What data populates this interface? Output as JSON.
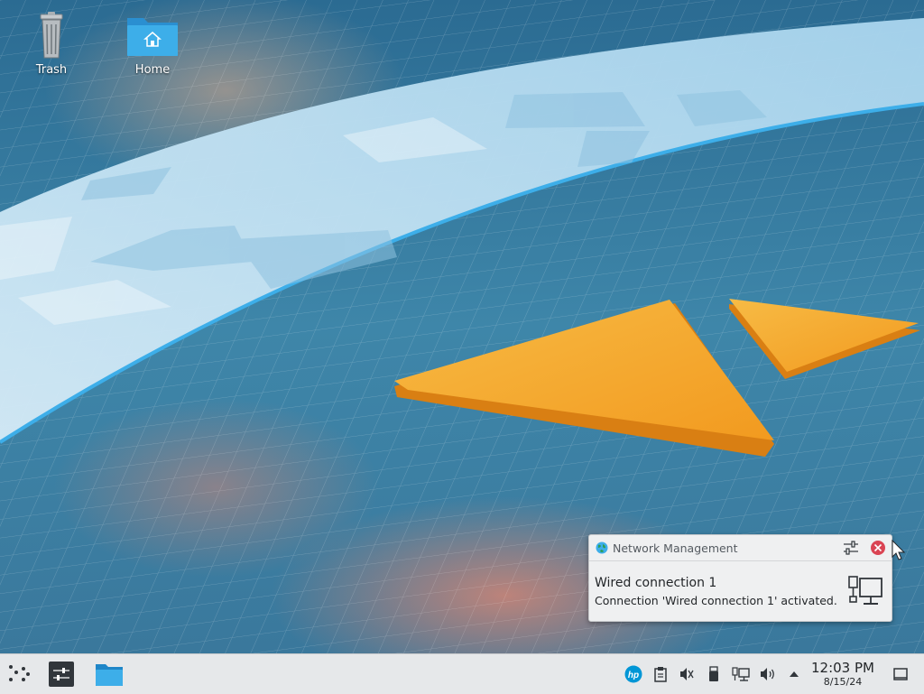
{
  "desktop": {
    "icons": [
      {
        "label": "Trash",
        "icon": "trash-icon"
      },
      {
        "label": "Home",
        "icon": "home-folder-icon"
      }
    ]
  },
  "notification": {
    "app_name": "Network Management",
    "title": "Wired connection 1",
    "body": "Connection 'Wired connection 1' activated.",
    "app_icon": "network-globe-icon",
    "config_icon": "settings-sliders-icon",
    "close_icon": "close-icon",
    "content_icon": "wired-network-icon"
  },
  "taskbar": {
    "launcher_icon": "application-launcher-icon",
    "tasks": [
      {
        "name": "System Settings",
        "icon": "settings-icon"
      },
      {
        "name": "Files",
        "icon": "folder-icon"
      }
    ],
    "tray": [
      {
        "name": "HP",
        "icon": "hp-icon"
      },
      {
        "name": "Clipboard",
        "icon": "clipboard-icon"
      },
      {
        "name": "Audio muted",
        "icon": "speaker-muted-icon"
      },
      {
        "name": "Devices",
        "icon": "usb-device-icon"
      },
      {
        "name": "Network",
        "icon": "network-wired-icon"
      },
      {
        "name": "Volume",
        "icon": "volume-icon"
      },
      {
        "name": "Show hidden icons",
        "icon": "arrow-up-icon"
      }
    ],
    "clock": {
      "time": "12:03 PM",
      "date": "8/15/24"
    },
    "show_desktop_icon": "show-desktop-icon"
  },
  "colors": {
    "accent": "#3daee9",
    "orange": "#f5a623",
    "close_red": "#da4453"
  }
}
